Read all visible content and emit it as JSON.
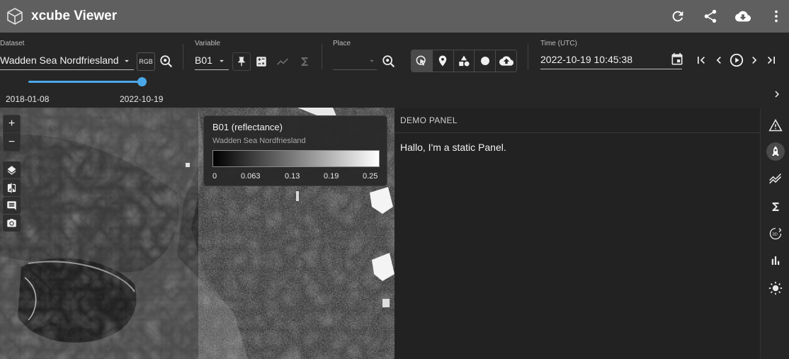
{
  "app": {
    "title": "xcube Viewer"
  },
  "toolbar_right": {
    "icons": [
      "refresh-icon",
      "share-icon",
      "cloud-download-icon",
      "more-vert-icon"
    ]
  },
  "dataset": {
    "label": "Dataset",
    "value": "Wadden Sea Nordfriesland",
    "rgb_label": "RGB"
  },
  "variable": {
    "label": "Variable",
    "value": "B01"
  },
  "place": {
    "label": "Place",
    "value": ""
  },
  "time": {
    "label": "Time (UTC)",
    "value": "2022-10-19 10:45:38"
  },
  "time_range": {
    "start": "2018-01-08",
    "end": "2022-10-19",
    "position": 1.0
  },
  "map": {
    "zoom_in": "+",
    "zoom_out": "−",
    "legend": {
      "title": "B01 (reflectance)",
      "subtitle": "Wadden Sea Nordfriesland",
      "ticks": [
        "0",
        "0.063",
        "0.13",
        "0.19",
        "0.25"
      ],
      "colormap": [
        "#000000",
        "#ffffff"
      ]
    }
  },
  "panel": {
    "header": "DEMO PANEL",
    "content": "Hallo, I'm a static Panel."
  },
  "sidebar": {
    "icons": [
      "warning-icon",
      "rocket-icon",
      "stacked-line-icon",
      "sigma-icon",
      "view-3d-icon",
      "bar-chart-icon",
      "brightness-icon"
    ],
    "selected": 1
  },
  "colors": {
    "accent": "#4aa8e8",
    "appbar": "#5f5f5f",
    "toolbar": "#262626"
  }
}
